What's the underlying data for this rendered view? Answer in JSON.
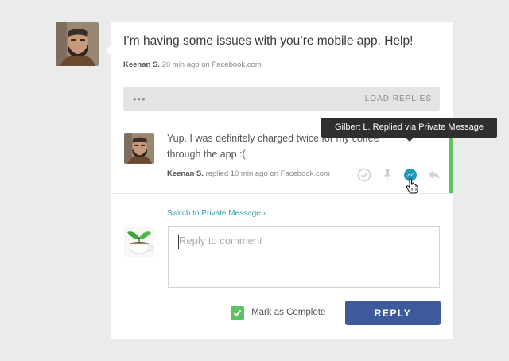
{
  "post": {
    "text": "I’m having some issues with you’re mobile app. Help!",
    "author": "Keenan S.",
    "time": "20 min ago",
    "source_prefix": "on",
    "source": "Facebook.com"
  },
  "load_replies": {
    "dots": "•••",
    "label": "LOAD REPLIES"
  },
  "reply": {
    "text": "Yup. I was definitely charged twice for my coffee through the app :(",
    "author": "Keenan S.",
    "action": "replied",
    "time": "10 min ago",
    "source_prefix": "on",
    "source": "Facebook.com",
    "actions": [
      "check-icon",
      "pin-icon",
      "messenger-icon",
      "reply-icon"
    ]
  },
  "tooltip": {
    "text": "Gilbert L. Replied via Private Message"
  },
  "composer": {
    "switch_link": "Switch to Private Message ›",
    "placeholder": "Reply to comment",
    "mark_complete_label": "Mark as Complete",
    "mark_complete_checked": true,
    "reply_button": "REPLY"
  },
  "colors": {
    "accent_green": "#5cc35f",
    "link_teal": "#2c9cb3",
    "button_blue": "#3d5a9c",
    "messenger_teal": "#2297b6"
  }
}
